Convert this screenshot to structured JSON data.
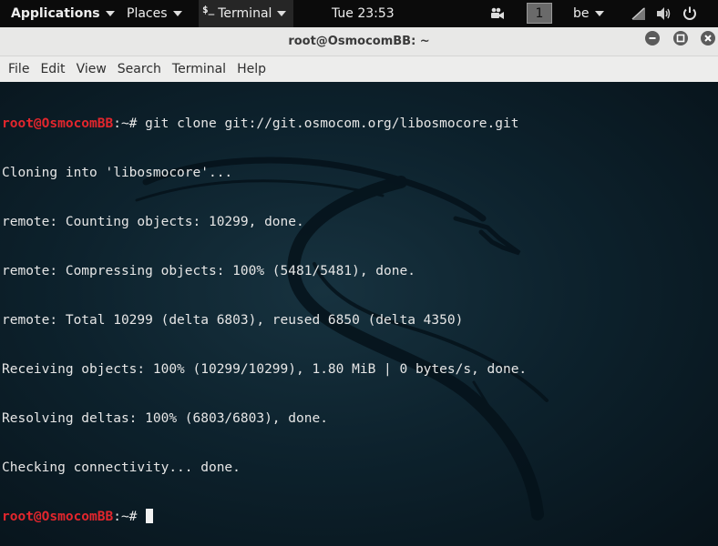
{
  "panel": {
    "applications": "Applications",
    "places": "Places",
    "terminal_glyph": "$_",
    "terminal": "Terminal",
    "clock": "Tue 23:53",
    "workspace": "1",
    "language": "be"
  },
  "window": {
    "title": "root@OsmocomBB: ~"
  },
  "menu": {
    "file": "File",
    "edit": "Edit",
    "view": "View",
    "search": "Search",
    "terminal": "Terminal",
    "help": "Help"
  },
  "terminal": {
    "prompt_user": "root@OsmocomBB",
    "prompt_path": ":~#",
    "command": " git clone git://git.osmocom.org/libosmocore.git",
    "output": [
      "Cloning into 'libosmocore'...",
      "remote: Counting objects: 10299, done.",
      "remote: Compressing objects: 100% (5481/5481), done.",
      "remote: Total 10299 (delta 6803), reused 6850 (delta 4350)",
      "Receiving objects: 100% (10299/10299), 1.80 MiB | 0 bytes/s, done.",
      "Resolving deltas: 100% (6803/6803), done.",
      "Checking connectivity... done."
    ]
  },
  "icons": {
    "window_buttons": [
      "minimize-icon",
      "maximize-icon",
      "close-icon"
    ],
    "tray": [
      "camera-icon",
      "network-icon",
      "volume-icon",
      "power-icon"
    ]
  },
  "colors": {
    "prompt_user": "#e3262d",
    "terminal_bg": "#0d222d",
    "panel_bg": "#0b0b0b"
  }
}
